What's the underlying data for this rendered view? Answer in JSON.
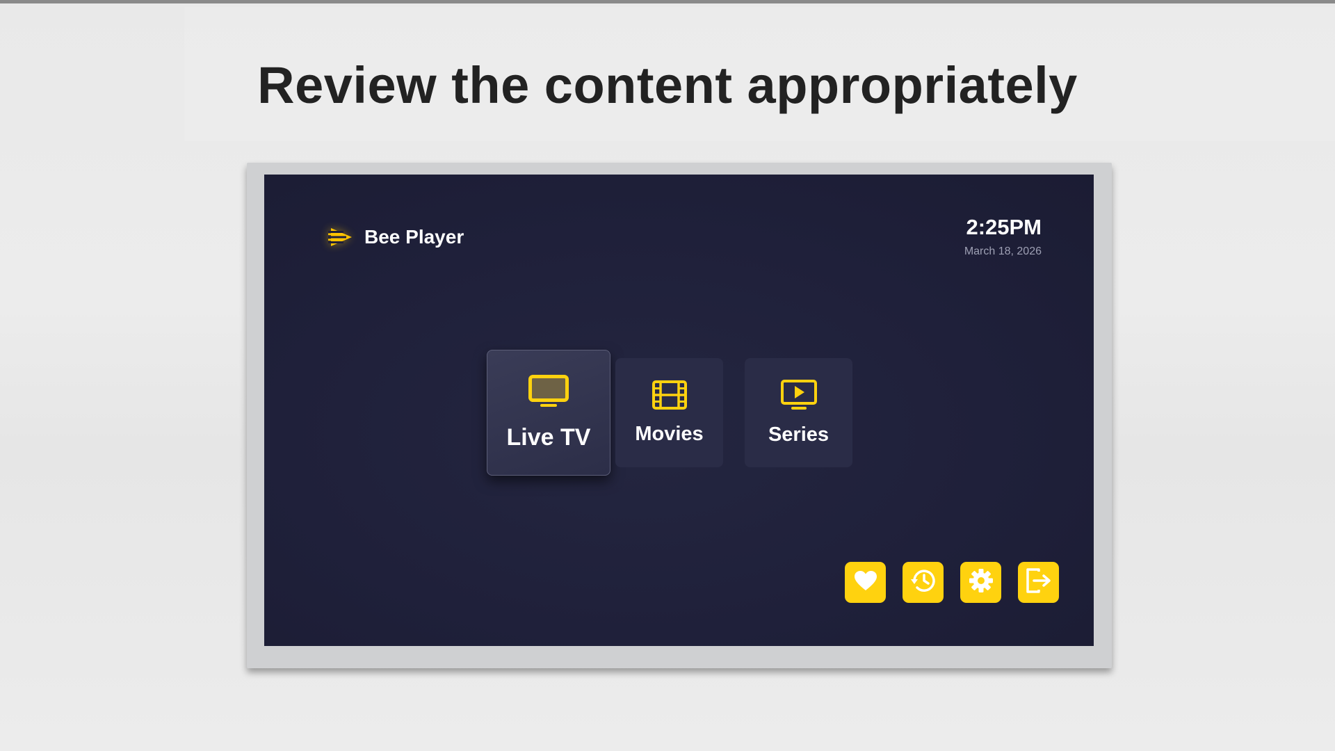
{
  "headline": "Review the content appropriately",
  "app": {
    "name": "Bee Player",
    "logo_icon": "bee-player-logo-icon"
  },
  "clock": {
    "time": "2:25PM",
    "date": "March 18, 2026"
  },
  "menu": {
    "focused": "Live TV",
    "tiles": [
      {
        "label": "Live TV",
        "icon": "tv-icon"
      },
      {
        "label": "Movies",
        "icon": "film-icon"
      },
      {
        "label": "Series",
        "icon": "play-screen-icon"
      }
    ]
  },
  "actions": [
    {
      "icon": "heart-icon"
    },
    {
      "icon": "history-icon"
    },
    {
      "icon": "gear-icon"
    },
    {
      "icon": "logout-icon"
    }
  ],
  "colors": {
    "accent": "#ffd20f",
    "screen_background": "#1f203a",
    "tile_background": "#2a2c47",
    "text_primary": "#ffffff",
    "text_secondary": "#9ea0b4"
  }
}
